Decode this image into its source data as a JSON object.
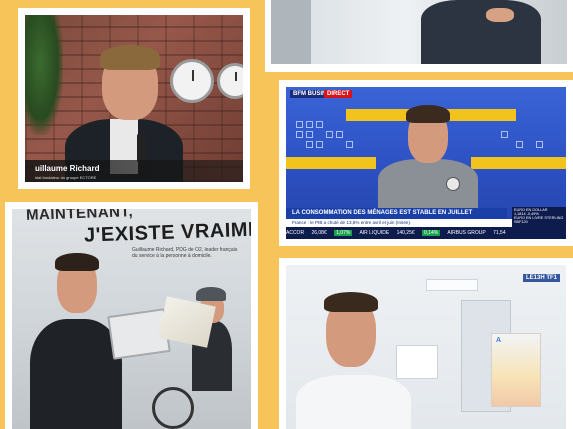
{
  "panel1": {
    "lower_third_name": "uillaume Richard",
    "lower_third_role": "idat fondateur du groupe ECTORE"
  },
  "panel3": {
    "channel": "BFM BUSINESS",
    "live_label": "DIRECT",
    "headline": "LA CONSOMMATION DES MÉNAGES EST STABLE EN JUILLET",
    "subline": "France : le PIB a chuté de 13,8% entre avril et juin (Insee).",
    "ticker": [
      {
        "name": "ACCOR",
        "value": "26,08€",
        "change": "1,07%"
      },
      {
        "name": "AIR LIQUIDE",
        "value": "140,25€",
        "change": "0,14%"
      },
      {
        "name": "AIRBUS GROUP",
        "value": "71,54"
      }
    ],
    "side_box": {
      "line1": "EURO EN DOLLAR",
      "line2": "1,1814  -0,49%",
      "line3": "EURO EN LIVRE STERLING",
      "line4": "SBF120"
    }
  },
  "panel4": {
    "title_line1": "MAINTENANT,",
    "title_line2": "J'EXISTE VRAIMENT.",
    "body": "Guillaume Richard, PDG de O2, leader français du service à la personne à domicile."
  },
  "panel5": {
    "logo": "LE13H TF1",
    "poster_letter": "A"
  },
  "colors": {
    "background": "#f7c45a",
    "bfm_blue": "#2c50c2",
    "bfm_yellow": "#f2c21d"
  }
}
